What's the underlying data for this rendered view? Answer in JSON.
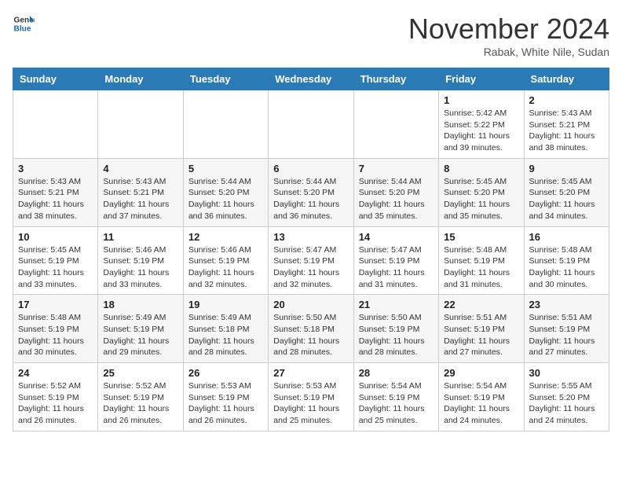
{
  "logo": {
    "general": "General",
    "blue": "Blue"
  },
  "title": "November 2024",
  "location": "Rabak, White Nile, Sudan",
  "weekdays": [
    "Sunday",
    "Monday",
    "Tuesday",
    "Wednesday",
    "Thursday",
    "Friday",
    "Saturday"
  ],
  "weeks": [
    [
      {
        "day": "",
        "info": ""
      },
      {
        "day": "",
        "info": ""
      },
      {
        "day": "",
        "info": ""
      },
      {
        "day": "",
        "info": ""
      },
      {
        "day": "",
        "info": ""
      },
      {
        "day": "1",
        "sunrise": "Sunrise: 5:42 AM",
        "sunset": "Sunset: 5:22 PM",
        "daylight": "Daylight: 11 hours and 39 minutes."
      },
      {
        "day": "2",
        "sunrise": "Sunrise: 5:43 AM",
        "sunset": "Sunset: 5:21 PM",
        "daylight": "Daylight: 11 hours and 38 minutes."
      }
    ],
    [
      {
        "day": "3",
        "sunrise": "Sunrise: 5:43 AM",
        "sunset": "Sunset: 5:21 PM",
        "daylight": "Daylight: 11 hours and 38 minutes."
      },
      {
        "day": "4",
        "sunrise": "Sunrise: 5:43 AM",
        "sunset": "Sunset: 5:21 PM",
        "daylight": "Daylight: 11 hours and 37 minutes."
      },
      {
        "day": "5",
        "sunrise": "Sunrise: 5:44 AM",
        "sunset": "Sunset: 5:20 PM",
        "daylight": "Daylight: 11 hours and 36 minutes."
      },
      {
        "day": "6",
        "sunrise": "Sunrise: 5:44 AM",
        "sunset": "Sunset: 5:20 PM",
        "daylight": "Daylight: 11 hours and 36 minutes."
      },
      {
        "day": "7",
        "sunrise": "Sunrise: 5:44 AM",
        "sunset": "Sunset: 5:20 PM",
        "daylight": "Daylight: 11 hours and 35 minutes."
      },
      {
        "day": "8",
        "sunrise": "Sunrise: 5:45 AM",
        "sunset": "Sunset: 5:20 PM",
        "daylight": "Daylight: 11 hours and 35 minutes."
      },
      {
        "day": "9",
        "sunrise": "Sunrise: 5:45 AM",
        "sunset": "Sunset: 5:20 PM",
        "daylight": "Daylight: 11 hours and 34 minutes."
      }
    ],
    [
      {
        "day": "10",
        "sunrise": "Sunrise: 5:45 AM",
        "sunset": "Sunset: 5:19 PM",
        "daylight": "Daylight: 11 hours and 33 minutes."
      },
      {
        "day": "11",
        "sunrise": "Sunrise: 5:46 AM",
        "sunset": "Sunset: 5:19 PM",
        "daylight": "Daylight: 11 hours and 33 minutes."
      },
      {
        "day": "12",
        "sunrise": "Sunrise: 5:46 AM",
        "sunset": "Sunset: 5:19 PM",
        "daylight": "Daylight: 11 hours and 32 minutes."
      },
      {
        "day": "13",
        "sunrise": "Sunrise: 5:47 AM",
        "sunset": "Sunset: 5:19 PM",
        "daylight": "Daylight: 11 hours and 32 minutes."
      },
      {
        "day": "14",
        "sunrise": "Sunrise: 5:47 AM",
        "sunset": "Sunset: 5:19 PM",
        "daylight": "Daylight: 11 hours and 31 minutes."
      },
      {
        "day": "15",
        "sunrise": "Sunrise: 5:48 AM",
        "sunset": "Sunset: 5:19 PM",
        "daylight": "Daylight: 11 hours and 31 minutes."
      },
      {
        "day": "16",
        "sunrise": "Sunrise: 5:48 AM",
        "sunset": "Sunset: 5:19 PM",
        "daylight": "Daylight: 11 hours and 30 minutes."
      }
    ],
    [
      {
        "day": "17",
        "sunrise": "Sunrise: 5:48 AM",
        "sunset": "Sunset: 5:19 PM",
        "daylight": "Daylight: 11 hours and 30 minutes."
      },
      {
        "day": "18",
        "sunrise": "Sunrise: 5:49 AM",
        "sunset": "Sunset: 5:19 PM",
        "daylight": "Daylight: 11 hours and 29 minutes."
      },
      {
        "day": "19",
        "sunrise": "Sunrise: 5:49 AM",
        "sunset": "Sunset: 5:18 PM",
        "daylight": "Daylight: 11 hours and 28 minutes."
      },
      {
        "day": "20",
        "sunrise": "Sunrise: 5:50 AM",
        "sunset": "Sunset: 5:18 PM",
        "daylight": "Daylight: 11 hours and 28 minutes."
      },
      {
        "day": "21",
        "sunrise": "Sunrise: 5:50 AM",
        "sunset": "Sunset: 5:19 PM",
        "daylight": "Daylight: 11 hours and 28 minutes."
      },
      {
        "day": "22",
        "sunrise": "Sunrise: 5:51 AM",
        "sunset": "Sunset: 5:19 PM",
        "daylight": "Daylight: 11 hours and 27 minutes."
      },
      {
        "day": "23",
        "sunrise": "Sunrise: 5:51 AM",
        "sunset": "Sunset: 5:19 PM",
        "daylight": "Daylight: 11 hours and 27 minutes."
      }
    ],
    [
      {
        "day": "24",
        "sunrise": "Sunrise: 5:52 AM",
        "sunset": "Sunset: 5:19 PM",
        "daylight": "Daylight: 11 hours and 26 minutes."
      },
      {
        "day": "25",
        "sunrise": "Sunrise: 5:52 AM",
        "sunset": "Sunset: 5:19 PM",
        "daylight": "Daylight: 11 hours and 26 minutes."
      },
      {
        "day": "26",
        "sunrise": "Sunrise: 5:53 AM",
        "sunset": "Sunset: 5:19 PM",
        "daylight": "Daylight: 11 hours and 26 minutes."
      },
      {
        "day": "27",
        "sunrise": "Sunrise: 5:53 AM",
        "sunset": "Sunset: 5:19 PM",
        "daylight": "Daylight: 11 hours and 25 minutes."
      },
      {
        "day": "28",
        "sunrise": "Sunrise: 5:54 AM",
        "sunset": "Sunset: 5:19 PM",
        "daylight": "Daylight: 11 hours and 25 minutes."
      },
      {
        "day": "29",
        "sunrise": "Sunrise: 5:54 AM",
        "sunset": "Sunset: 5:19 PM",
        "daylight": "Daylight: 11 hours and 24 minutes."
      },
      {
        "day": "30",
        "sunrise": "Sunrise: 5:55 AM",
        "sunset": "Sunset: 5:20 PM",
        "daylight": "Daylight: 11 hours and 24 minutes."
      }
    ]
  ]
}
